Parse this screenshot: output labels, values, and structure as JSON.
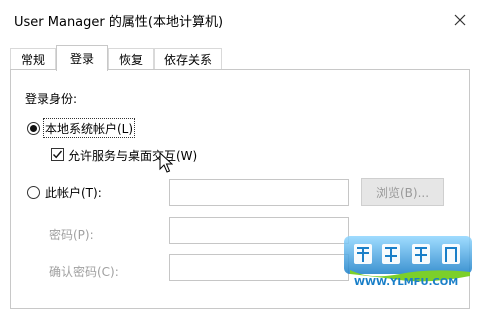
{
  "window": {
    "title": "User Manager 的属性(本地计算机)",
    "close_icon": "close-icon"
  },
  "tabs": [
    {
      "label": "常规",
      "active": false
    },
    {
      "label": "登录",
      "active": true
    },
    {
      "label": "恢复",
      "active": false
    },
    {
      "label": "依存关系",
      "active": false
    }
  ],
  "logon": {
    "section_label": "登录身份:",
    "local_system": {
      "label": "本地系统帐户(L)",
      "selected": true
    },
    "interact_desktop": {
      "label": "允许服务与桌面交互(W)",
      "checked": true
    },
    "this_account": {
      "label": "此帐户(T):",
      "selected": false,
      "value": ""
    },
    "browse_button": "浏览(B)...",
    "password": {
      "label": "密码(P):",
      "value": ""
    },
    "confirm_password": {
      "label": "确认密码(C):",
      "value": ""
    }
  },
  "watermark": {
    "brand": "雨林木风",
    "url": "WWW.YLMFU.COM",
    "accent": "#1a8fd8"
  }
}
